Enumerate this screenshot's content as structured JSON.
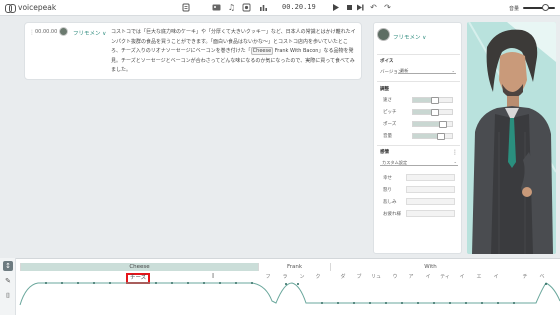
{
  "app": {
    "name": "voicepeak"
  },
  "toolbar": {
    "time": "00.20.19",
    "volume_label": "音量",
    "icons": [
      "list-icon",
      "image-icon",
      "music-note-icon",
      "dictionary-icon",
      "play-icon",
      "stop-icon",
      "skip-icon",
      "undo-icon",
      "redo-icon"
    ]
  },
  "editor": {
    "timestamp": "00.00.00",
    "speaker": "フリモメン",
    "dropdown_arrow": "∨",
    "text_before": "コストコでは「巨大な底力味のケーキ」や「分厚くて大きいクッキー」など、日本人の常識とはかけ離れたインパクト抜群の食品を買うことができます。「面白い食品はないかな～」とコストコ店内を歩いていたところ、チーズ入りのリオナソーセージにベーコンを巻き付けた「",
    "highlight": "Cheese",
    "text_after": " Frank With Bacon」なる品物を発見。チーズとソーセージとベーコンが合わさってどんな味になるのか気になったので、実際に買って食べてみました。"
  },
  "panel": {
    "speaker": "フリモメン",
    "voice_section": "ボイス",
    "version_label": "バージョン",
    "version_value": "最新",
    "tuning_section": "調整",
    "speed_label": "速さ",
    "pitch_label": "ピッチ",
    "pause_label": "ポーズ",
    "volume_label": "音量",
    "emotion_section": "感情",
    "emotion_select": "カスタム設定",
    "emotions": [
      "幸せ",
      "怒り",
      "悲しみ",
      "お疲れ様"
    ]
  },
  "timeline": {
    "words": [
      "Cheese",
      "Frank",
      "With"
    ],
    "phoneme_input": "チーズ",
    "phonemes_frank": [
      "フ",
      "ラ",
      "ン",
      "ク"
    ],
    "phonemes_with": [
      "ダ",
      "ブ",
      "リュ",
      "ウ",
      "ア",
      "イ",
      "ティ",
      "イ",
      "エ",
      "イ",
      "チ",
      "ベ"
    ]
  },
  "colors": {
    "accent": "#2e8b7e",
    "selection_highlight": "#e5151b",
    "word_selected_bg": "#cbded9",
    "portrait_bg": "#b9e2dd"
  }
}
